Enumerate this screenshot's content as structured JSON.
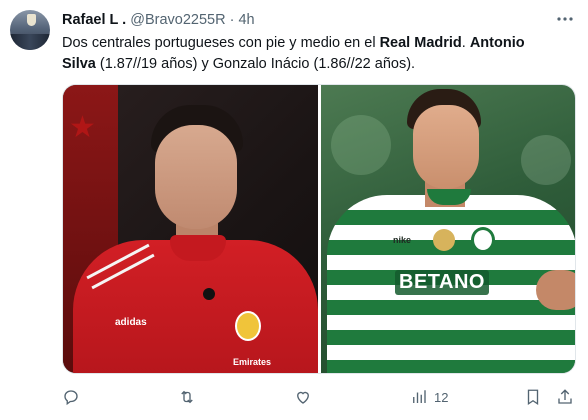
{
  "tweet": {
    "author": {
      "name": "Rafael L .",
      "handle": "@Bravo2255R",
      "separator": "·",
      "time": "4h"
    },
    "text": {
      "part1": "Dos centrales portugueses con pie y medio en el ",
      "club": "Real Madrid",
      "part2": ". ",
      "player1": "Antonio Silva",
      "part3": " (1.87//19 años) y Gonzalo Inácio (1.86//22 años)."
    },
    "media": {
      "left_image": {
        "jersey_brand": "adidas",
        "sponsor": "Emirates"
      },
      "right_image": {
        "jersey_brand": "nike",
        "sponsor": "BETANO"
      }
    },
    "actions": {
      "views_count": "12"
    },
    "colors": {
      "text": "#0f1419",
      "secondary": "#536471",
      "benfica_red": "#d21f25",
      "sporting_green": "#1f7a3d"
    }
  },
  "icons": {
    "more": "more-horizontal-icon",
    "reply": "reply-icon",
    "retweet": "retweet-icon",
    "like": "heart-icon",
    "views": "views-icon",
    "bookmark": "bookmark-icon",
    "share": "share-icon"
  }
}
